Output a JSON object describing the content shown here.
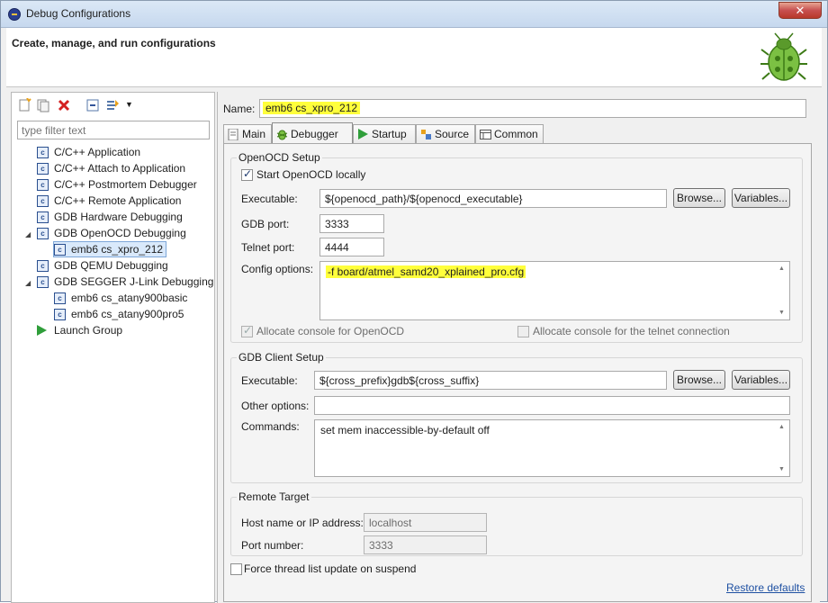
{
  "window": {
    "title": "Debug Configurations",
    "close": "✕"
  },
  "header": {
    "title": "Create, manage, and run configurations"
  },
  "left": {
    "filter_placeholder": "type filter text",
    "tree": [
      {
        "label": "C/C++ Application"
      },
      {
        "label": "C/C++ Attach to Application"
      },
      {
        "label": "C/C++ Postmortem Debugger"
      },
      {
        "label": "C/C++ Remote Application"
      },
      {
        "label": "GDB Hardware Debugging"
      },
      {
        "label": "GDB OpenOCD Debugging"
      },
      {
        "label": "emb6 cs_xpro_212"
      },
      {
        "label": "GDB QEMU Debugging"
      },
      {
        "label": "GDB SEGGER J-Link Debugging"
      },
      {
        "label": "emb6 cs_atany900basic"
      },
      {
        "label": "emb6 cs_atany900pro5"
      },
      {
        "label": "Launch Group"
      }
    ],
    "icon_char": "c"
  },
  "right": {
    "name_label": "Name:",
    "name_value": "emb6 cs_xpro_212",
    "tabs": [
      "Main",
      "Debugger",
      "Startup",
      "Source",
      "Common"
    ],
    "openocd": {
      "title": "OpenOCD Setup",
      "start_locally": "Start OpenOCD locally",
      "executable_label": "Executable:",
      "executable_value": "${openocd_path}/${openocd_executable}",
      "browse": "Browse...",
      "variables": "Variables...",
      "gdb_port_label": "GDB port:",
      "gdb_port_value": "3333",
      "telnet_port_label": "Telnet port:",
      "telnet_port_value": "4444",
      "config_label": "Config options:",
      "config_value": "-f board/atmel_samd20_xplained_pro.cfg",
      "alloc_console": "Allocate console for OpenOCD",
      "alloc_telnet": "Allocate console for the telnet connection"
    },
    "gdbclient": {
      "title": "GDB Client Setup",
      "executable_label": "Executable:",
      "executable_value": "${cross_prefix}gdb${cross_suffix}",
      "browse": "Browse...",
      "variables": "Variables...",
      "other_label": "Other options:",
      "other_value": "",
      "commands_label": "Commands:",
      "commands_value": "set mem inaccessible-by-default off"
    },
    "remote": {
      "title": "Remote Target",
      "host_label": "Host name or IP address:",
      "host_value": "localhost",
      "port_label": "Port number:",
      "port_value": "3333"
    },
    "force_thread": "Force thread list update on suspend",
    "restore": "Restore defaults"
  }
}
